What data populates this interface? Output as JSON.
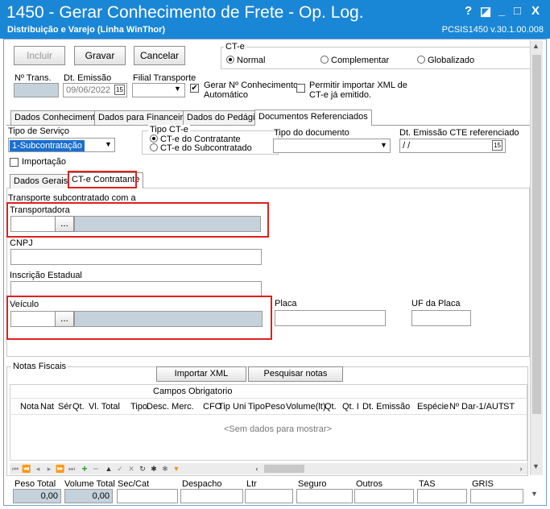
{
  "window": {
    "title": "1450 - Gerar Conhecimento de Frete - Op. Log.",
    "subtitle": "Distribuição e Varejo (Linha WinThor)",
    "version": "PCSIS1450  v.30.1.00.008",
    "controls": [
      "?",
      "◪",
      "_",
      "□",
      "X"
    ]
  },
  "toolbar": {
    "incluir": "Incluir",
    "gravar": "Gravar",
    "cancelar": "Cancelar"
  },
  "cte": {
    "group_label": "CT-e",
    "options": [
      "Normal",
      "Complementar",
      "Globalizado"
    ],
    "selected": "Normal"
  },
  "fields": {
    "num_trans_label": "Nº Trans.",
    "num_trans_value": "",
    "dt_emissao_label": "Dt. Emissão",
    "dt_emissao_value": "09/06/2022",
    "date_btn": "15",
    "filial_label": "Filial Transporte",
    "filial_value": "",
    "gerar_label_1": "Gerar Nº Conhecimento",
    "gerar_label_2": "Automático",
    "gerar_checked": "✔",
    "permitir_label_1": "Permitir importar XML de",
    "permitir_label_2": "CT-e já emitido."
  },
  "main_tabs": [
    "Dados Conhecimento",
    "Dados para Financeiro",
    "Dados do Pedágio",
    "Documentos Referenciados"
  ],
  "docref": {
    "tipo_servico_label": "Tipo de Serviço",
    "tipo_servico_value": "1-Subcontratação",
    "tipo_cte_label": "Tipo CT-e",
    "tipo_cte_options": [
      "CT-e do Contratante",
      "CT-e do Subcontratado"
    ],
    "tipo_doc_label": "Tipo do documento",
    "tipo_doc_value": "",
    "dt_emissao_cte_label": "Dt. Emissão CTE referenciado",
    "dt_emissao_cte_value": " / /",
    "date_btn": "15",
    "importacao_label": "Importação"
  },
  "sub_tabs": [
    "Dados Gerais",
    "CT-e Contratante"
  ],
  "contratante": {
    "transporte_label": "Transporte subcontratado com a",
    "transportadora_label": "Transportadora",
    "lookup_btn": "...",
    "cnpj_label": "CNPJ",
    "ie_label": "Inscrição Estadual",
    "veiculo_label": "Veículo",
    "placa_label": "Placa",
    "uf_placa_label": "UF da Placa"
  },
  "notas": {
    "group_label": "Notas Fiscais",
    "importar_btn": "Importar XML",
    "pesquisar_btn": "Pesquisar notas",
    "group_header": "Campos Obrigatorio",
    "columns": [
      "Nota",
      "Nat",
      "Sér",
      "Qt.",
      "Vl. Total",
      "Tipo",
      "Desc. Merc.",
      "CFO",
      "Tip",
      "Uni",
      "Tipo",
      "Peso",
      "Volume(lt)",
      "Qt.",
      "Qt. I",
      "Dt. Emissão",
      "Espécie",
      "Nº Dar-1/AUT",
      "ST"
    ],
    "empty_text": "<Sem dados para mostrar>",
    "nav_icons": [
      "first-icon",
      "prev-page-icon",
      "prev-icon",
      "next-icon",
      "next-page-icon",
      "last-icon",
      "add-icon",
      "remove-icon",
      "up-icon",
      "edit-icon",
      "cancel-icon",
      "refresh-icon",
      "asterisk-icon",
      "asterisk-disabled-icon",
      "filter-icon"
    ]
  },
  "totals": {
    "labels": [
      "Peso Total",
      "Volume Total",
      "Sec/Cat",
      "Despacho",
      "Ltr",
      "Seguro",
      "Outros",
      "TAS",
      "GRIS"
    ],
    "peso_total": "0,00",
    "volume_total": "0,00"
  },
  "colors": {
    "titlebar": "#1a86d6",
    "highlight": "#e02020",
    "accent_green": "#2a9a2a"
  }
}
